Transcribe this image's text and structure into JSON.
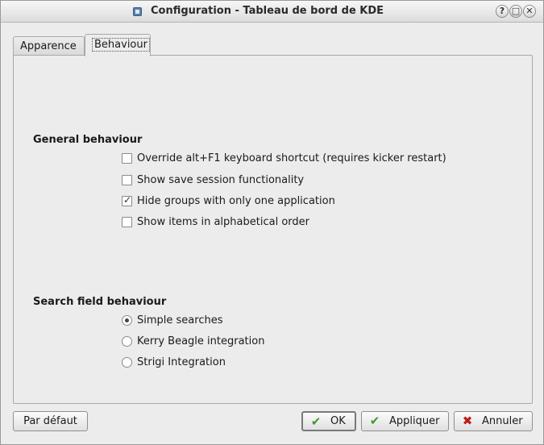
{
  "window": {
    "title": "Configuration - Tableau de bord de KDE",
    "title_buttons": [
      "?",
      "□",
      "✕"
    ]
  },
  "tabs": [
    {
      "label": "Apparence",
      "active": false
    },
    {
      "label": "Behaviour",
      "active": true
    }
  ],
  "general": {
    "title": "General behaviour",
    "options": [
      {
        "label": "Override alt+F1 keyboard shortcut (requires kicker restart)",
        "checked": false
      },
      {
        "label": "Show save session functionality",
        "checked": false
      },
      {
        "label": "Hide groups with only one application",
        "checked": true
      },
      {
        "label": "Show items in alphabetical order",
        "checked": false
      }
    ]
  },
  "search": {
    "title": "Search field behaviour",
    "options": [
      {
        "label": "Simple searches",
        "selected": true
      },
      {
        "label": "Kerry Beagle integration",
        "selected": false
      },
      {
        "label": "Strigi Integration",
        "selected": false
      }
    ]
  },
  "buttons": {
    "defaults": "Par défaut",
    "ok": "OK",
    "apply": "Appliquer",
    "cancel": "Annuler"
  },
  "icons": {
    "help": "help-icon",
    "maximize": "maximize-icon",
    "close": "close-icon",
    "ok": "check-icon",
    "apply": "check-icon",
    "cancel": "cross-icon"
  },
  "colors": {
    "ok_icon": "#3f9a2f",
    "cancel_icon": "#c01818"
  }
}
